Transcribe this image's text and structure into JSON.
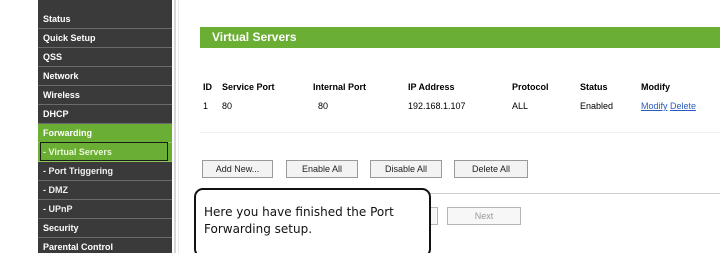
{
  "sidebar": {
    "items": [
      {
        "label": "Status"
      },
      {
        "label": "Quick Setup"
      },
      {
        "label": "QSS"
      },
      {
        "label": "Network"
      },
      {
        "label": "Wireless"
      },
      {
        "label": "DHCP"
      },
      {
        "label": "Forwarding"
      },
      {
        "label": "- Virtual Servers"
      },
      {
        "label": "- Port Triggering"
      },
      {
        "label": "- DMZ"
      },
      {
        "label": "- UPnP"
      },
      {
        "label": "Security"
      },
      {
        "label": "Parental Control"
      }
    ]
  },
  "page": {
    "title": "Virtual Servers"
  },
  "table": {
    "headers": [
      "ID",
      "Service Port",
      "Internal Port",
      "IP Address",
      "Protocol",
      "Status",
      "Modify"
    ],
    "rows": [
      {
        "id": "1",
        "service_port": "80",
        "internal_port": "80",
        "ip": "192.168.1.107",
        "protocol": "ALL",
        "status": "Enabled",
        "modify": "Modify",
        "delete": "Delete"
      }
    ]
  },
  "buttons": {
    "add_new": "Add New...",
    "enable_all": "Enable All",
    "disable_all": "Disable All",
    "delete_all": "Delete All",
    "next": "Next"
  },
  "callout": {
    "text": "Here you have finished the Port Forwarding setup."
  },
  "colors": {
    "accent": "#6aae34",
    "sidebar_bg": "#3a3a3a",
    "link": "#2a5bbd"
  }
}
